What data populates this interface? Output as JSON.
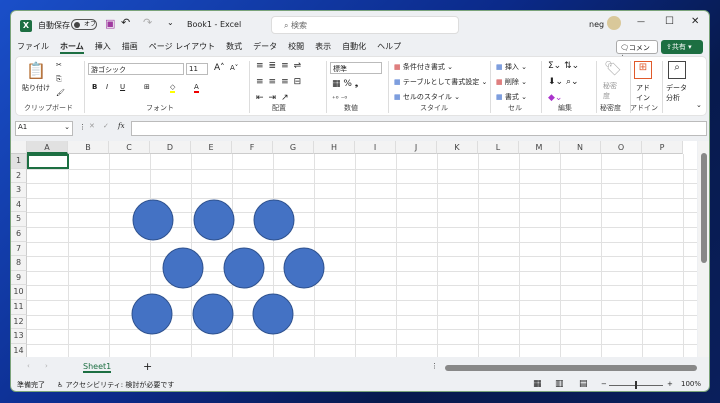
{
  "title": {
    "autosave_label": "自動保存",
    "autosave_state": "オフ",
    "doc_title": "Book1 - Excel",
    "search_placeholder": "検索",
    "user": "neg"
  },
  "menu": {
    "tabs": [
      "ファイル",
      "ホーム",
      "挿入",
      "描画",
      "ページ レイアウト",
      "数式",
      "データ",
      "校閲",
      "表示",
      "自動化",
      "ヘルプ"
    ],
    "active": "ホーム",
    "comment": "コメント",
    "share": "共有"
  },
  "ribbon": {
    "clipboard": {
      "paste": "貼り付け",
      "group": "クリップボード"
    },
    "font": {
      "name": "游ゴシック",
      "size": "11",
      "group": "フォント"
    },
    "alignment": {
      "group": "配置"
    },
    "number": {
      "format": "標準",
      "group": "数値"
    },
    "styles": {
      "conditional": "条件付き書式",
      "table": "テーブルとして書式設定",
      "cell_styles": "セルのスタイル",
      "group": "スタイル"
    },
    "cells": {
      "insert": "挿入",
      "delete": "削除",
      "format": "書式",
      "group": "セル"
    },
    "editing": {
      "group": "編集"
    },
    "sensitivity": {
      "label": "秘密度",
      "group": "秘密度"
    },
    "addins": {
      "label": "アドイン",
      "group": "アドイン"
    },
    "analyze": {
      "label": "データ分析"
    }
  },
  "formula_bar": {
    "name_box": "A1",
    "fx": "fx",
    "value": ""
  },
  "columns": [
    "A",
    "B",
    "C",
    "D",
    "E",
    "F",
    "G",
    "H",
    "I",
    "J",
    "K",
    "L",
    "M",
    "N",
    "O",
    "P"
  ],
  "rows": [
    "1",
    "2",
    "3",
    "4",
    "5",
    "6",
    "7",
    "8",
    "9",
    "10",
    "11",
    "12",
    "13",
    "14"
  ],
  "shapes": {
    "type": "circle",
    "count": 9,
    "fill": "#4472C4",
    "stroke": "#2F528F"
  },
  "sheets": {
    "tabs": [
      "Sheet1"
    ],
    "active": "Sheet1"
  },
  "status": {
    "ready": "準備完了",
    "accessibility": "アクセシビリティ: 検討が必要です",
    "zoom": "100%"
  },
  "colors": {
    "accent": "#1d6f42"
  }
}
